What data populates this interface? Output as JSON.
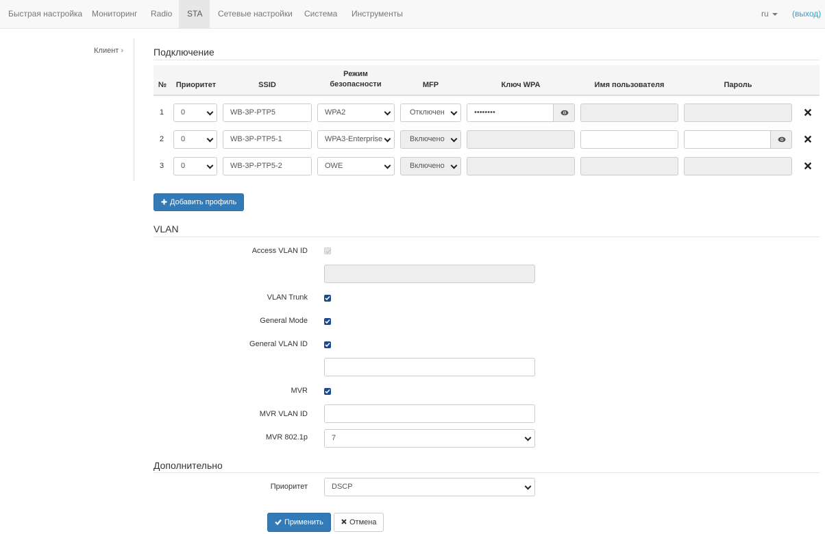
{
  "nav": {
    "items": [
      "Быстрая настройка",
      "Мониторинг",
      "Radio",
      "STA",
      "Сетевые настройки",
      "Система",
      "Инструменты"
    ],
    "active": "STA",
    "lang": "ru",
    "logout": "(выход)"
  },
  "sidebar": {
    "items": [
      {
        "label": "Клиент"
      }
    ]
  },
  "connection": {
    "title": "Подключение",
    "headers": {
      "num": "№",
      "priority": "Приоритет",
      "ssid": "SSID",
      "security_line1": "Режим",
      "security_line2": "безопасности",
      "mfp": "MFP",
      "wpa_key": "Ключ WPA",
      "username": "Имя пользователя",
      "password": "Пароль"
    },
    "rows": [
      {
        "num": "1",
        "priority": "0",
        "ssid": "WB-3P-PTP5",
        "security": "WPA2",
        "mfp": "Отключен",
        "wpa_key": "••••••••",
        "username": "",
        "password": ""
      },
      {
        "num": "2",
        "priority": "0",
        "ssid": "WB-3P-PTP5-1",
        "security": "WPA3-Enterprise",
        "mfp": "Включено",
        "wpa_key": "",
        "username": "",
        "password": ""
      },
      {
        "num": "3",
        "priority": "0",
        "ssid": "WB-3P-PTP5-2",
        "security": "OWE",
        "mfp": "Включено",
        "wpa_key": "",
        "username": "",
        "password": ""
      }
    ],
    "add_button": "Добавить профиль"
  },
  "vlan": {
    "title": "VLAN",
    "access_vlan_id": {
      "label": "Access VLAN ID",
      "checked": true,
      "disabled": true,
      "value": ""
    },
    "vlan_trunk": {
      "label": "VLAN Trunk",
      "checked": true
    },
    "general_mode": {
      "label": "General Mode",
      "checked": true
    },
    "general_vlan_id": {
      "label": "General VLAN ID",
      "checked": true,
      "value": ""
    },
    "mvr": {
      "label": "MVR",
      "checked": true
    },
    "mvr_vlan_id": {
      "label": "MVR VLAN ID",
      "value": ""
    },
    "mvr_8021p": {
      "label": "MVR 802.1p",
      "value": "7"
    }
  },
  "additional": {
    "title": "Дополнительно",
    "priority": {
      "label": "Приоритет",
      "value": "DSCP"
    }
  },
  "actions": {
    "apply": "Применить",
    "cancel": "Отмена"
  },
  "colors": {
    "primary": "#337ab7",
    "link": "#2a9fd6",
    "checkbox": "#1a4a8a"
  }
}
